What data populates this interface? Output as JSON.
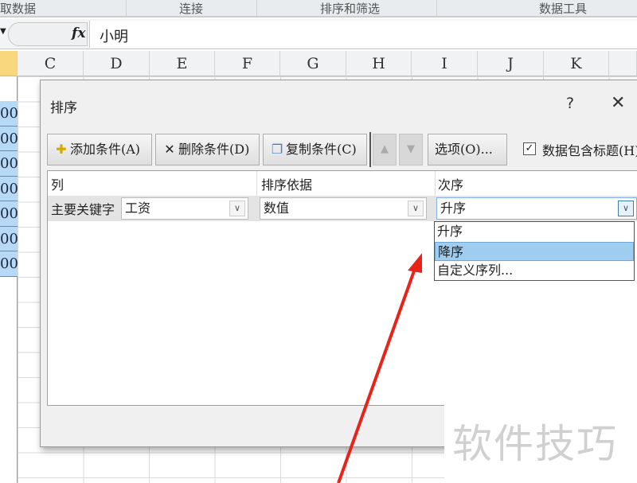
{
  "ribbon": {
    "groups": [
      "取数据",
      "连接",
      "排序和筛选",
      "数据工具"
    ]
  },
  "formula_bar": {
    "fx": "fx",
    "value": "小明"
  },
  "columns": [
    "C",
    "D",
    "E",
    "F",
    "G",
    "H",
    "I",
    "J",
    "K"
  ],
  "cells": [
    "00",
    "00",
    "00",
    "00",
    "00",
    "00",
    "00"
  ],
  "dialog": {
    "title": "排序",
    "help": "?",
    "close": "✕",
    "add_label": "添加条件(A)",
    "delete_label": "删除条件(D)",
    "copy_label": "复制条件(C)",
    "options_label": "选项(O)...",
    "header_checkbox": {
      "label": "数据包含标题(H)",
      "checked": true
    },
    "list_headers": {
      "column": "列",
      "sort_on": "排序依据",
      "order": "次序"
    },
    "row": {
      "label": "主要关键字",
      "column": "工资",
      "sort_on": "数值",
      "order": "升序"
    },
    "order_options": [
      "升序",
      "降序",
      "自定义序列..."
    ],
    "highlighted_option": "降序"
  },
  "watermark": "软件技巧",
  "annotation_color": "#e8231a"
}
